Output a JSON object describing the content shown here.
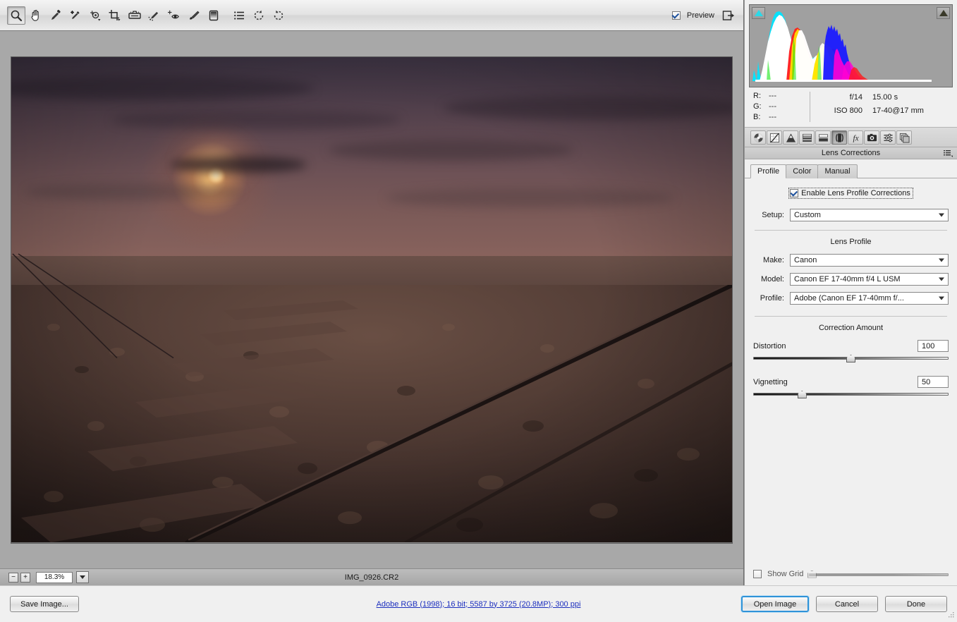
{
  "app": {
    "title": "Adobe Camera Raw"
  },
  "toolbar": {
    "tools": [
      {
        "name": "zoom-tool-icon",
        "label": "Zoom Tool",
        "active": true
      },
      {
        "name": "hand-tool-icon",
        "label": "Hand Tool",
        "active": false
      },
      {
        "name": "white-balance-tool-icon",
        "label": "White Balance Tool",
        "active": false
      },
      {
        "name": "color-sampler-tool-icon",
        "label": "Color Sampler Tool",
        "active": false
      },
      {
        "name": "targeted-adjustment-tool-icon",
        "label": "Targeted Adjustment Tool",
        "active": false
      },
      {
        "name": "crop-tool-icon",
        "label": "Crop Tool",
        "active": false
      },
      {
        "name": "straighten-tool-icon",
        "label": "Straighten Tool",
        "active": false
      },
      {
        "name": "spot-removal-tool-icon",
        "label": "Spot Removal",
        "active": false
      },
      {
        "name": "red-eye-removal-tool-icon",
        "label": "Red Eye Removal",
        "active": false
      },
      {
        "name": "adjustment-brush-tool-icon",
        "label": "Adjustment Brush",
        "active": false
      },
      {
        "name": "graduated-filter-tool-icon",
        "label": "Graduated Filter",
        "active": false
      },
      {
        "name": "open-preferences-icon",
        "label": "Open Preferences Dialog",
        "active": false
      },
      {
        "name": "rotate-counterclockwise-icon",
        "label": "Rotate Image 90 Counterclockwise",
        "active": false
      },
      {
        "name": "rotate-clockwise-icon",
        "label": "Rotate Image 90 Clockwise",
        "active": false
      }
    ],
    "preview_label": "Preview",
    "preview_checked": true,
    "fullscreen_name": "toggle-fullscreen-icon"
  },
  "histogram": {
    "shadow_clipping_name": "shadow-clipping-warning",
    "highlight_clipping_name": "highlight-clipping-warning",
    "shadow_clipping_color": "#2ad9e8",
    "highlight_clipping_color": "#3a3a2a"
  },
  "readout": {
    "rgb": [
      {
        "channel": "R:",
        "value": "---"
      },
      {
        "channel": "G:",
        "value": "---"
      },
      {
        "channel": "B:",
        "value": "---"
      }
    ],
    "aperture": "f/14",
    "shutter": "15.00 s",
    "iso": "ISO 800",
    "lens": "17-40@17 mm"
  },
  "panel_icons": [
    {
      "name": "basic-panel-icon",
      "label": "Basic",
      "active": false
    },
    {
      "name": "tone-curve-panel-icon",
      "label": "Tone Curve",
      "active": false
    },
    {
      "name": "detail-panel-icon",
      "label": "Detail",
      "active": false
    },
    {
      "name": "hsl-grayscale-panel-icon",
      "label": "HSL / Grayscale",
      "active": false
    },
    {
      "name": "split-toning-panel-icon",
      "label": "Split Toning",
      "active": false
    },
    {
      "name": "lens-corrections-panel-icon",
      "label": "Lens Corrections",
      "active": true
    },
    {
      "name": "effects-panel-icon",
      "label": "Effects",
      "active": false
    },
    {
      "name": "camera-calibration-panel-icon",
      "label": "Camera Calibration",
      "active": false
    },
    {
      "name": "presets-panel-icon",
      "label": "Presets",
      "active": false
    },
    {
      "name": "snapshots-panel-icon",
      "label": "Snapshots",
      "active": false
    }
  ],
  "panel": {
    "title": "Lens Corrections",
    "flyout_name": "panel-flyout-menu-icon",
    "tabs": [
      {
        "label": "Profile",
        "active": true
      },
      {
        "label": "Color",
        "active": false
      },
      {
        "label": "Manual",
        "active": false
      }
    ],
    "enable_label": "Enable Lens Profile Corrections",
    "enable_checked": true,
    "setup_label": "Setup:",
    "setup_value": "Custom",
    "lens_profile_title": "Lens Profile",
    "make_label": "Make:",
    "make_value": "Canon",
    "model_label": "Model:",
    "model_value": "Canon EF 17-40mm f/4 L USM",
    "profile_label": "Profile:",
    "profile_value": "Adobe (Canon EF 17-40mm f/...",
    "correction_title": "Correction Amount",
    "sliders": [
      {
        "name": "Distortion",
        "value": "100",
        "percent": 50
      },
      {
        "name": "Vignetting",
        "value": "50",
        "percent": 25
      }
    ],
    "show_grid_label": "Show Grid",
    "show_grid_checked": false,
    "grid_slider_percent": 2
  },
  "statusbar": {
    "zoom_out_glyph": "−",
    "zoom_in_glyph": "+",
    "zoom_value": "18.3%",
    "filename": "IMG_0926.CR2"
  },
  "bottom": {
    "save_image_label": "Save Image...",
    "workflow_link": "Adobe RGB (1998); 16 bit; 5587 by 3725 (20.8MP); 300 ppi",
    "open_image_label": "Open Image",
    "cancel_label": "Cancel",
    "done_label": "Done"
  },
  "photo": {
    "description": "Desert dusk landscape with railroad tracks leading to distant mountains and a glowing moon"
  }
}
